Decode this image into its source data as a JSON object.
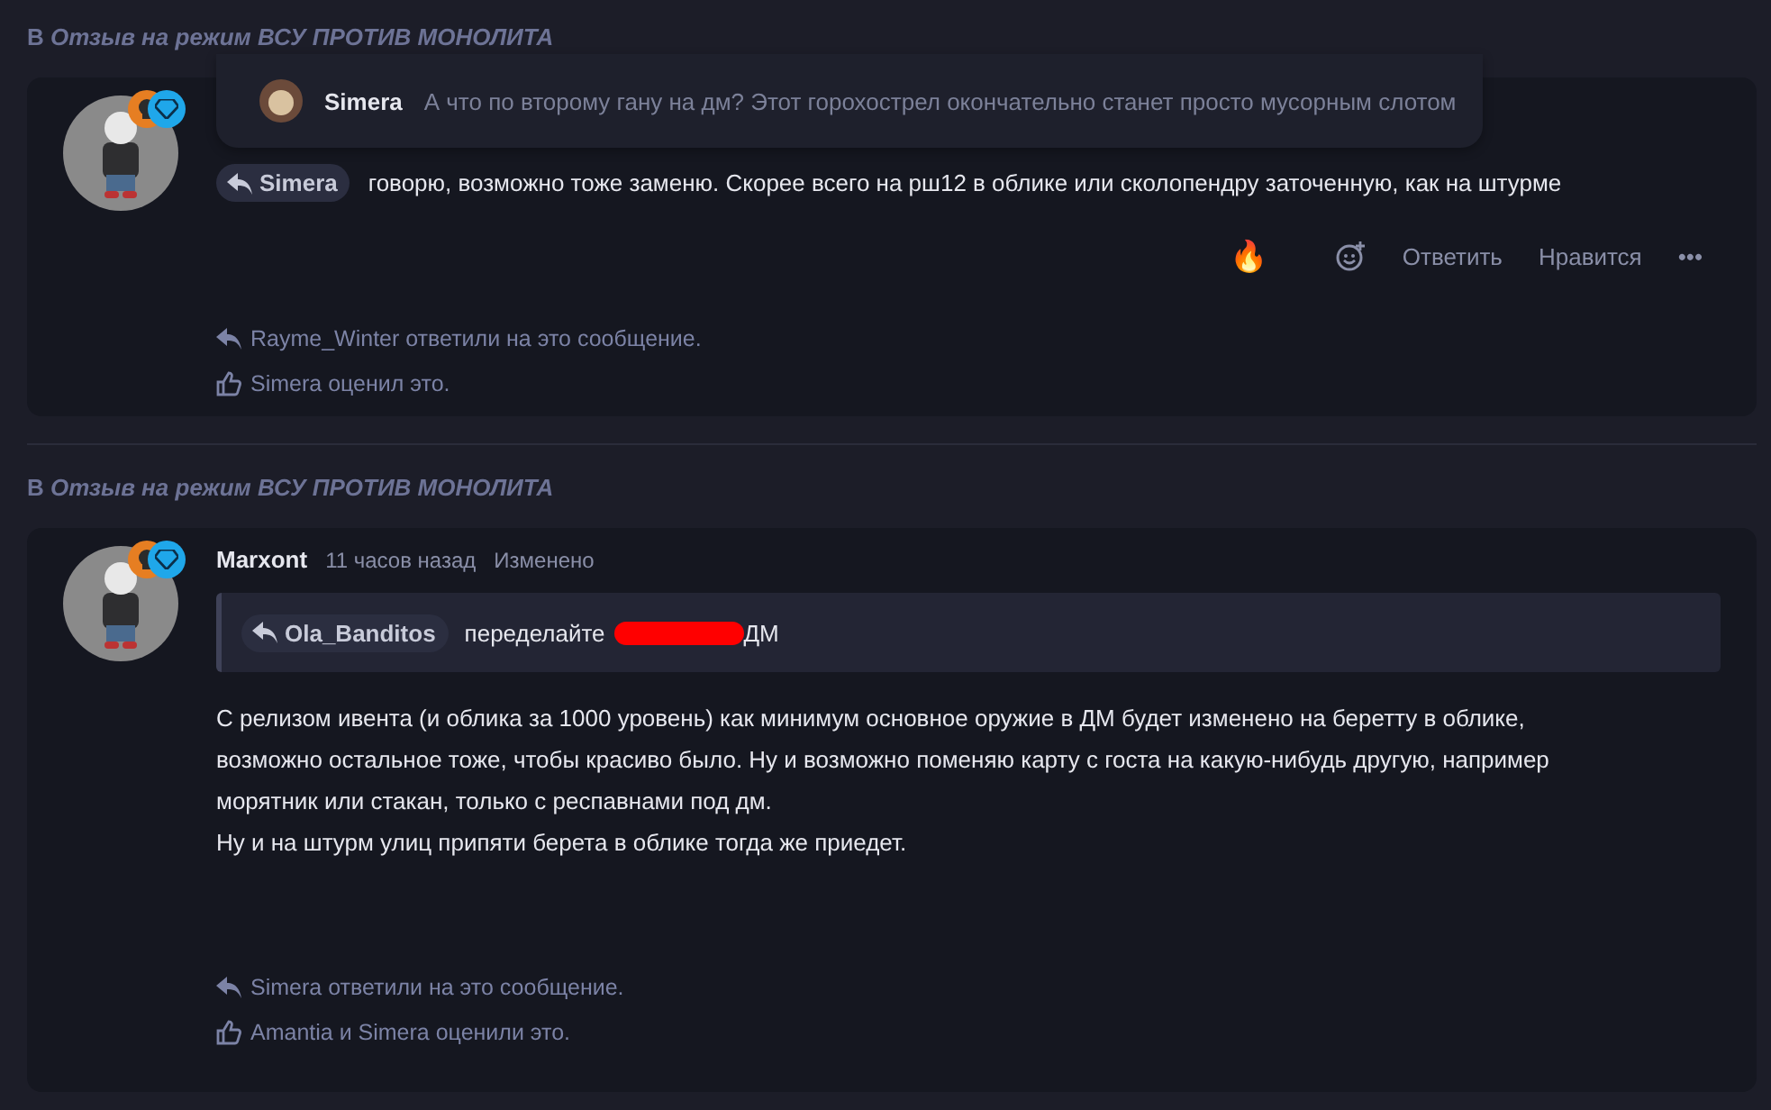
{
  "posts": [
    {
      "thread": {
        "prefix": "В",
        "title": "Отзыв на режим ВСУ ПРОТИВ МОНОЛИТА"
      },
      "popup": {
        "author": "Simera",
        "text": "А что по второму гану на дм? Этот горохострел окончательно станет просто мусорным слотом"
      },
      "mention": "Simera",
      "text": "говорю, возможно тоже заменю. Скорее всего на рш12 в облике или сколопендру заточенную, как на штурме",
      "actions": {
        "reaction": "🔥",
        "reply": "Ответить",
        "like": "Нравится",
        "more": "•••"
      },
      "footer": [
        {
          "kind": "reply",
          "text": "Rayme_Winter ответили на это сообщение."
        },
        {
          "kind": "like",
          "text": "Simera оценил это."
        }
      ]
    },
    {
      "thread": {
        "prefix": "В",
        "title": "Отзыв на режим ВСУ ПРОТИВ МОНОЛИТА"
      },
      "author": "Marxont",
      "time": "11 часов назад",
      "edited": "Изменено",
      "quote": {
        "mention": "Ola_Banditos",
        "segments": [
          {
            "kind": "text",
            "text": "переделайте"
          },
          {
            "kind": "redacted"
          },
          {
            "kind": "text",
            "text": "ДМ"
          }
        ]
      },
      "body": [
        "С релизом ивента (и облика за 1000 уровень) как минимум основное оружие в ДМ будет изменено на беретту в облике,",
        "возможно остальное тоже, чтобы красиво было. Ну и возможно поменяю карту с госта на какую-нибудь другую, например",
        "морятник или стакан, только с респавнами под дм.",
        "Ну и на штурм улиц припяти берета в облике тогда же приедет."
      ],
      "footer": [
        {
          "kind": "reply",
          "text": "Simera ответили на это сообщение."
        },
        {
          "kind": "like",
          "text": "Amantia и Simera оценили это."
        }
      ]
    }
  ]
}
